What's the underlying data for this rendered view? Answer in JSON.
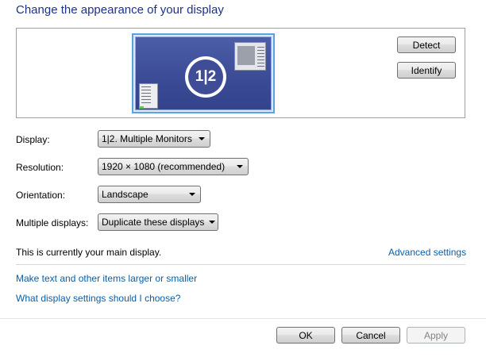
{
  "header": {
    "title": "Change the appearance of your display"
  },
  "preview": {
    "monitor_label": "1|2",
    "detect_label": "Detect",
    "identify_label": "Identify"
  },
  "settings": {
    "display": {
      "label": "Display:",
      "value": "1|2. Multiple Monitors"
    },
    "resolution": {
      "label": "Resolution:",
      "value": "1920 × 1080 (recommended)"
    },
    "orientation": {
      "label": "Orientation:",
      "value": "Landscape"
    },
    "multiple_displays": {
      "label": "Multiple displays:",
      "value": "Duplicate these displays"
    }
  },
  "status": {
    "main_display_text": "This is currently your main display.",
    "advanced_settings_link": "Advanced settings"
  },
  "links": {
    "text_size": "Make text and other items larger or smaller",
    "help": "What display settings should I choose?"
  },
  "footer": {
    "ok_label": "OK",
    "cancel_label": "Cancel",
    "apply_label": "Apply"
  },
  "colors": {
    "title": "#1e3287",
    "link": "#0b5ea6",
    "monitor_border": "#5aa2e0",
    "desktop": "#3e4d96"
  }
}
